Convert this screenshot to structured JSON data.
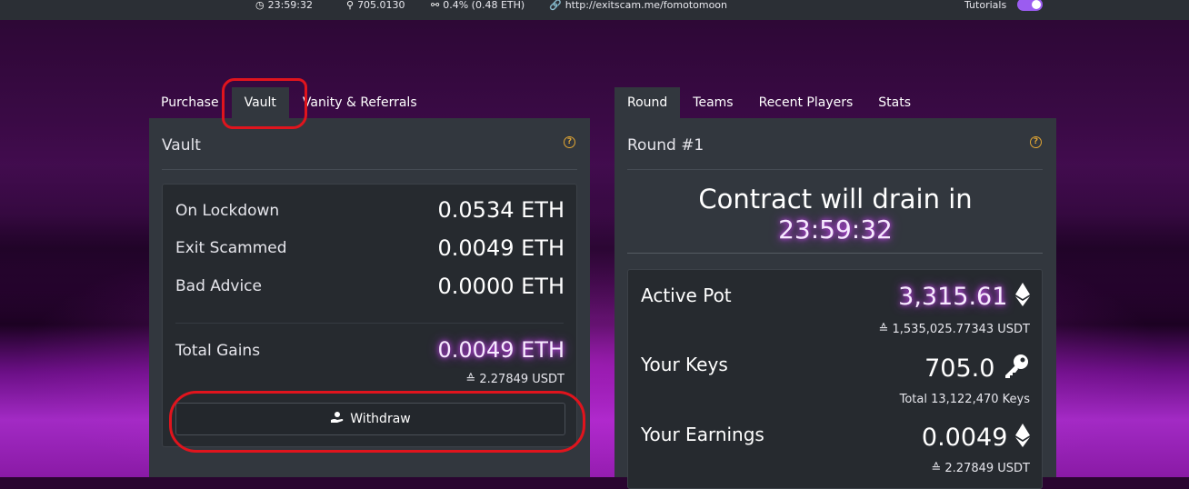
{
  "topbar": {
    "timer": "23:59:32",
    "keys": "705.0130",
    "share": "0.4% (0.48 ETH)",
    "referral_link": "http://exitscam.me/fomotomoon",
    "tutorials_label": "Tutorials",
    "tutorials_on": true
  },
  "left_tabs": [
    {
      "label": "Purchase",
      "active": false
    },
    {
      "label": "Vault",
      "active": true
    },
    {
      "label": "Vanity & Referrals",
      "active": false
    }
  ],
  "right_tabs": [
    {
      "label": "Round",
      "active": true
    },
    {
      "label": "Teams",
      "active": false
    },
    {
      "label": "Recent Players",
      "active": false
    },
    {
      "label": "Stats",
      "active": false
    }
  ],
  "vault": {
    "title": "Vault",
    "help_glyph": "?",
    "rows": [
      {
        "label": "On Lockdown",
        "value": "0.0534 ETH"
      },
      {
        "label": "Exit Scammed",
        "value": "0.0049 ETH"
      },
      {
        "label": "Bad Advice",
        "value": "0.0000 ETH"
      }
    ],
    "total_label": "Total Gains",
    "total_value": "0.0049 ETH",
    "total_usd": "≙ 2.27849 USDT",
    "withdraw_label": "Withdraw"
  },
  "round": {
    "title": "Round #1",
    "help_glyph": "?",
    "drain_title": "Contract will drain in",
    "drain_timer": "23:59:32",
    "active_pot_label": "Active Pot",
    "active_pot_value": "3,315.61",
    "active_pot_usd": "≙ 1,535,025.77343 USDT",
    "your_keys_label": "Your Keys",
    "your_keys_value": "705.0",
    "total_keys": "Total 13,122,470 Keys",
    "your_earnings_label": "Your Earnings",
    "your_earnings_value": "0.0049",
    "your_earnings_usd": "≙ 2.27849 USDT"
  },
  "colors": {
    "accent_purple": "#9b5cf0",
    "glow": "#d44cff",
    "help_orange": "#e0a534",
    "annotation_red": "#e0141d"
  }
}
